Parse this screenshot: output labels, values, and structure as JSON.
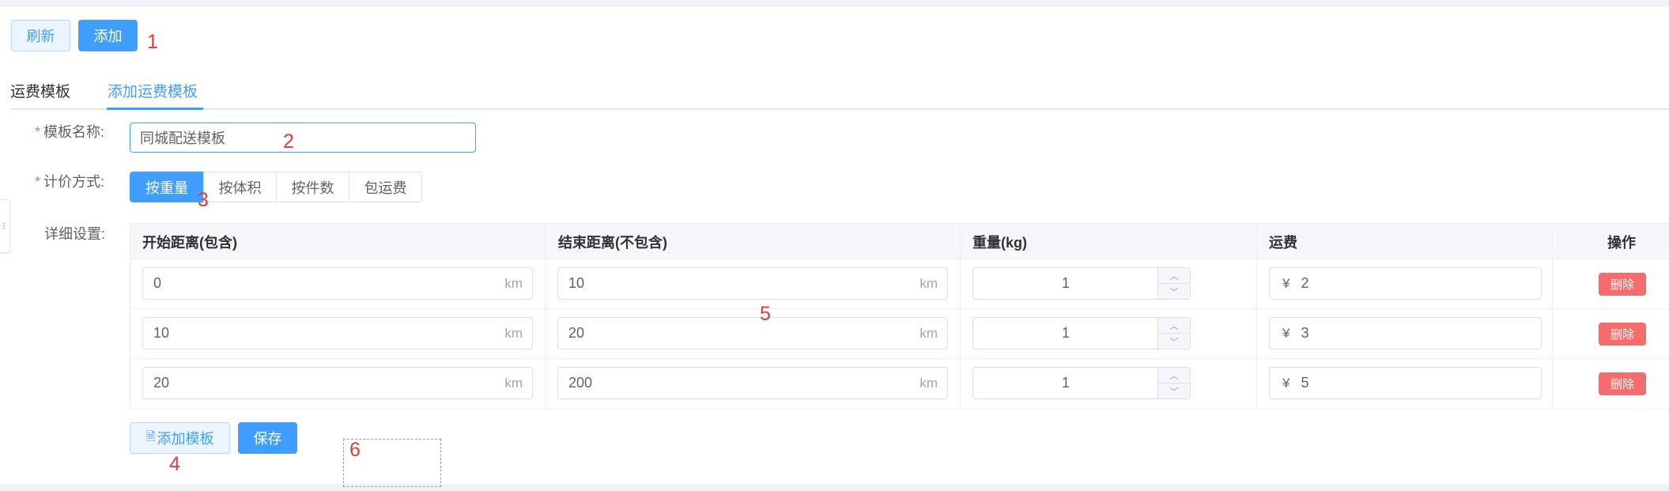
{
  "toolbar": {
    "refresh_label": "刷新",
    "add_label": "添加"
  },
  "markers": [
    "1",
    "2",
    "3",
    "4",
    "5",
    "6"
  ],
  "tabs": [
    {
      "label": "运费模板",
      "active": false
    },
    {
      "label": "添加运费模板",
      "active": true
    }
  ],
  "form": {
    "name_label": "模板名称:",
    "name_value": "同城配送模板",
    "pricing_label": "计价方式:",
    "pricing_options": [
      "按重量",
      "按体积",
      "按件数",
      "包运费"
    ],
    "pricing_selected": "按重量",
    "detail_label": "详细设置:"
  },
  "table": {
    "columns": [
      "开始距离(包含)",
      "结束距离(不包含)",
      "重量(kg)",
      "运费",
      "操作"
    ],
    "distance_unit": "km",
    "currency_symbol": "¥",
    "delete_label": "删除",
    "rows": [
      {
        "start": "0",
        "end": "10",
        "weight": "1",
        "fee": "2"
      },
      {
        "start": "10",
        "end": "20",
        "weight": "1",
        "fee": "3"
      },
      {
        "start": "20",
        "end": "200",
        "weight": "1",
        "fee": "5"
      }
    ]
  },
  "actions": {
    "add_template_label": "添加模板",
    "save_label": "保存"
  },
  "colors": {
    "primary": "#409eff",
    "danger": "#f56c6c",
    "marker": "#e53935"
  },
  "icons": {
    "stepper_up": "chevron-up-icon",
    "stepper_down": "chevron-down-icon",
    "add_template": "document-icon"
  }
}
